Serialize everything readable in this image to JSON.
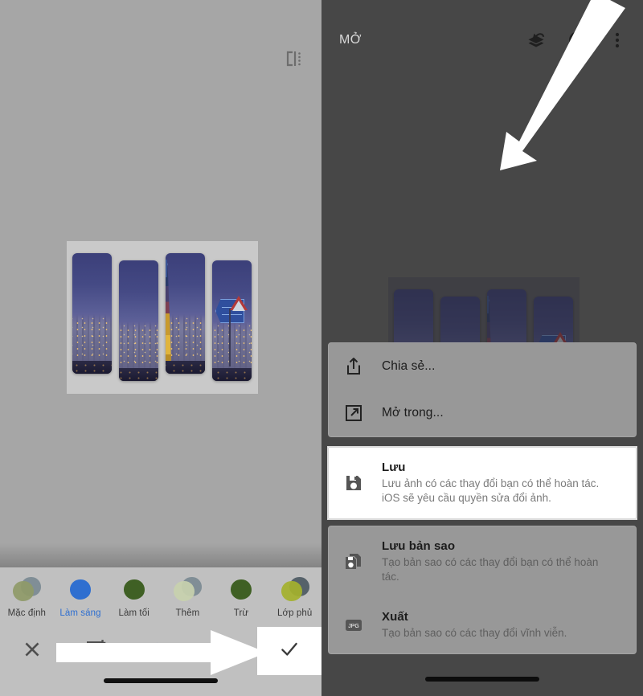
{
  "left_panel": {
    "compare_icon": "compare-split-icon",
    "blend_modes": [
      {
        "label": "Mặc định",
        "active": false,
        "swatch": [
          "#8f9a68",
          "#7b8a93"
        ]
      },
      {
        "label": "Làm sáng",
        "active": true,
        "swatch": [
          "#2f6fd0",
          "#2f6fd0"
        ]
      },
      {
        "label": "Làm tối",
        "active": false,
        "swatch": [
          "#3f6024",
          "#3f6024"
        ]
      },
      {
        "label": "Thêm",
        "active": false,
        "swatch": [
          "#c8d1ae",
          "#7b8a93"
        ]
      },
      {
        "label": "Trừ",
        "active": false,
        "swatch": [
          "#3f6024",
          "#3f6024"
        ]
      },
      {
        "label": "Lớp phủ",
        "active": false,
        "swatch": [
          "#a4b12c",
          "#4d5a63"
        ]
      }
    ],
    "toolbar": [
      {
        "icon": "close-icon",
        "name": "cancel-button",
        "highlighted": false
      },
      {
        "icon": "add-image-icon",
        "name": "add-image-button",
        "highlighted": false
      },
      {
        "icon": "blend-modes-icon",
        "name": "blend-modes-button",
        "highlighted": false
      },
      {
        "icon": "curve-icon",
        "name": "curve-button",
        "highlighted": false
      },
      {
        "icon": "checkmark-icon",
        "name": "confirm-button",
        "highlighted": true
      }
    ]
  },
  "right_panel": {
    "header": {
      "title": "MỞ",
      "icons": [
        {
          "name": "revert-layers-icon"
        },
        {
          "name": "info-icon"
        },
        {
          "name": "overflow-menu-icon"
        }
      ]
    },
    "menu_groups": [
      {
        "items": [
          {
            "icon": "share-icon",
            "title": "Chia sẻ...",
            "desc": "",
            "highlighted": false
          },
          {
            "icon": "open-in-icon",
            "title": "Mở trong...",
            "desc": "",
            "highlighted": false
          }
        ]
      },
      {
        "items": [
          {
            "icon": "save-icon",
            "title": "Lưu",
            "desc": "Lưu ảnh có các thay đổi bạn có thể hoàn tác. iOS sẽ yêu cầu quyền sửa đổi ảnh.",
            "highlighted": true
          }
        ]
      },
      {
        "items": [
          {
            "icon": "save-copy-icon",
            "title": "Lưu bản sao",
            "desc": "Tạo bản sao có các thay đổi bạn có thể hoàn tác.",
            "highlighted": false
          },
          {
            "icon": "jpg-export-icon",
            "title": "Xuất",
            "desc": "Tạo bản sao có các thay đổi vĩnh viễn.",
            "highlighted": false
          }
        ]
      }
    ]
  },
  "colors": {
    "left_bg": "#a6a6a6",
    "right_bg": "#474747",
    "toolbar_bg": "#c0c0c0",
    "sheet_bg": "#989898",
    "accent_blue": "#2f6fd0",
    "highlight_white": "#ffffff",
    "annotation_arrow": "#ffffff"
  },
  "annotations": [
    {
      "name": "arrow-to-save-item",
      "direction": "down-left"
    },
    {
      "name": "arrow-to-confirm-button",
      "direction": "right"
    }
  ]
}
